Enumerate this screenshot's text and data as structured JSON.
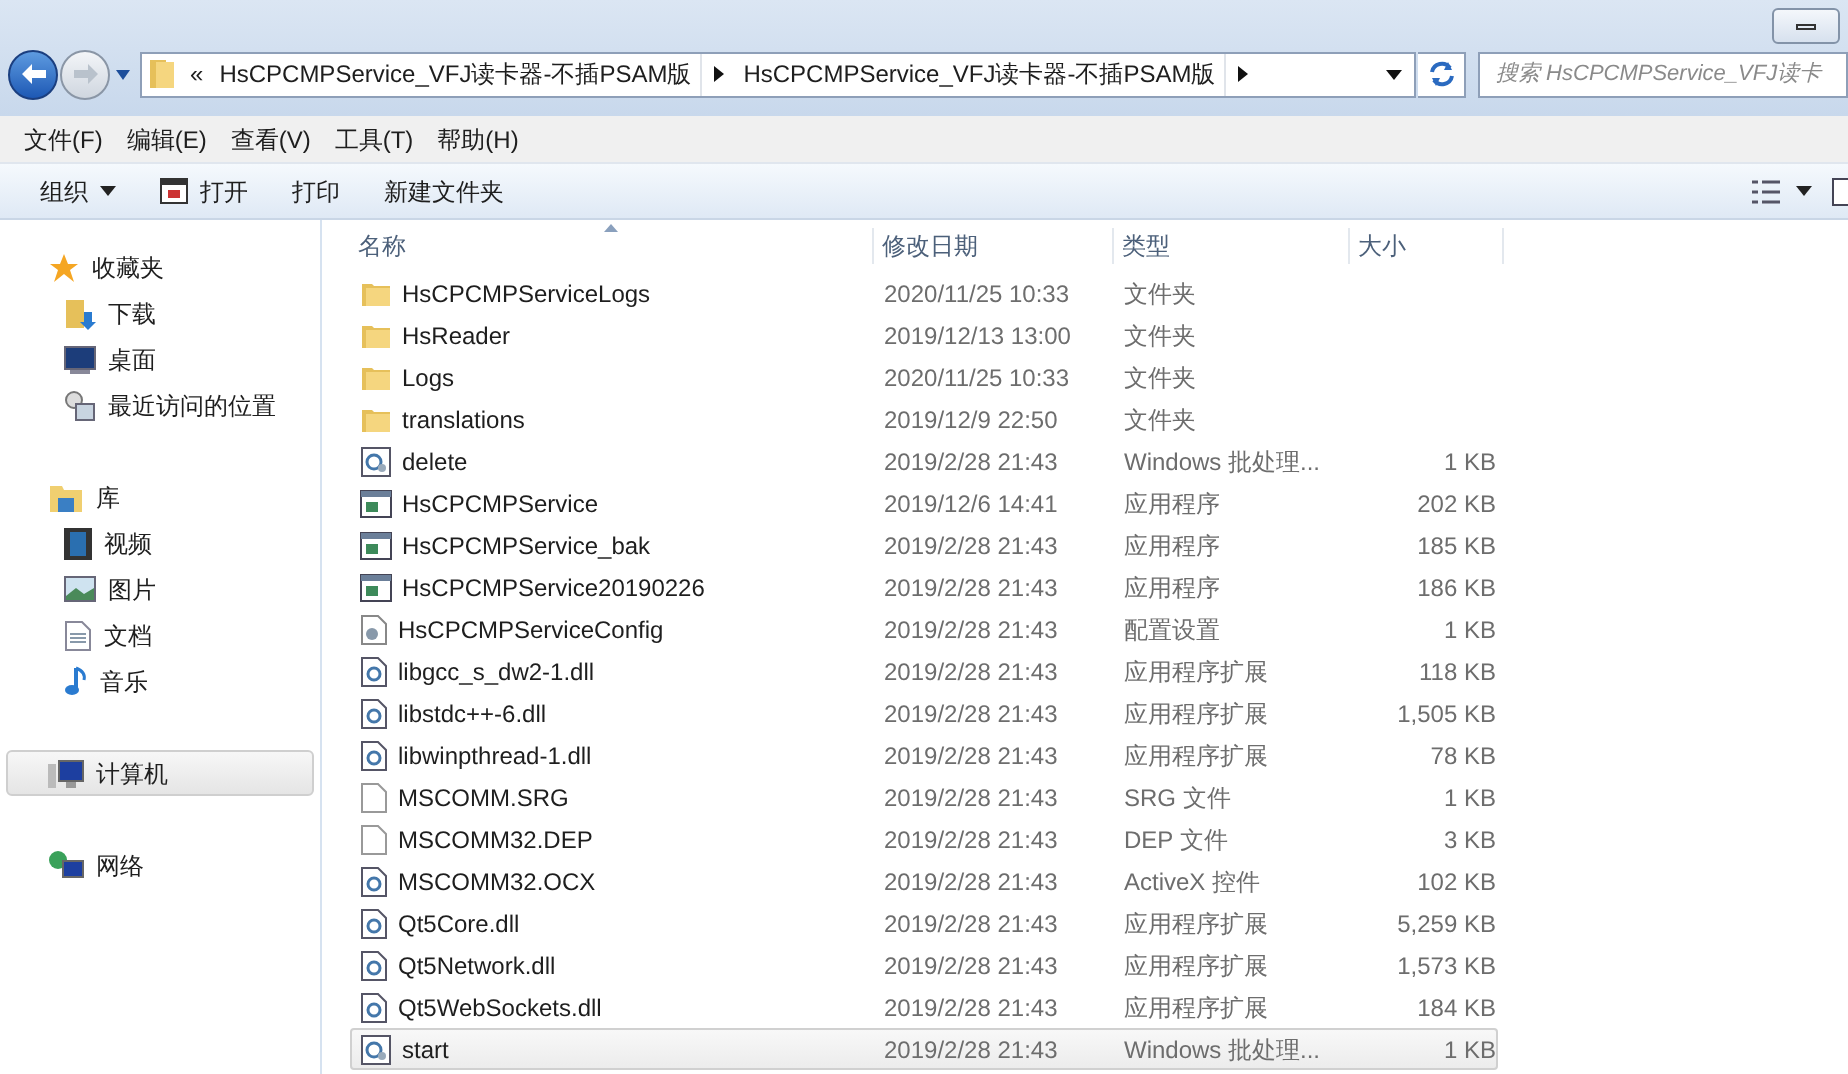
{
  "address_bar": {
    "overflow_marker": "«",
    "crumbs": [
      "HsCPCMPService_VFJ读卡器-不插PSAM版",
      "HsCPCMPService_VFJ读卡器-不插PSAM版"
    ]
  },
  "search": {
    "placeholder": "搜索 HsCPCMPService_VFJ读卡"
  },
  "menu": [
    "文件(F)",
    "编辑(E)",
    "查看(V)",
    "工具(T)",
    "帮助(H)"
  ],
  "toolbar": [
    {
      "label": "组织",
      "kind": "dropdown"
    },
    {
      "label": "打开",
      "kind": "icon"
    },
    {
      "label": "打印",
      "kind": "plain"
    },
    {
      "label": "新建文件夹",
      "kind": "plain"
    }
  ],
  "sidebar": {
    "groups": [
      {
        "label": "收藏夹",
        "kind": "favorites",
        "selected": false,
        "children": [
          {
            "label": "下载",
            "kind": "download"
          },
          {
            "label": "桌面",
            "kind": "desktop"
          },
          {
            "label": "最近访问的位置",
            "kind": "recent"
          }
        ]
      },
      {
        "label": "库",
        "kind": "library",
        "selected": false,
        "children": [
          {
            "label": "视频",
            "kind": "video"
          },
          {
            "label": "图片",
            "kind": "picture"
          },
          {
            "label": "文档",
            "kind": "document"
          },
          {
            "label": "音乐",
            "kind": "music"
          }
        ]
      },
      {
        "label": "计算机",
        "kind": "computer",
        "selected": true
      },
      {
        "label": "网络",
        "kind": "network",
        "selected": false
      }
    ]
  },
  "table": {
    "columns": [
      "名称",
      "修改日期",
      "类型",
      "大小"
    ],
    "rows": [
      {
        "name": "HsCPCMPServiceLogs",
        "date": "2020/11/25 10:33",
        "type": "文件夹",
        "kind": "folder",
        "selected": false
      },
      {
        "name": "HsReader",
        "date": "2019/12/13 13:00",
        "type": "文件夹",
        "kind": "folder",
        "selected": false
      },
      {
        "name": "Logs",
        "date": "2020/11/25 10:33",
        "type": "文件夹",
        "kind": "folder",
        "selected": false
      },
      {
        "name": "translations",
        "date": "2019/12/9 22:50",
        "type": "文件夹",
        "kind": "folder",
        "selected": false
      },
      {
        "name": "delete",
        "date": "2019/2/28 21:43",
        "type": "Windows 批处理...",
        "size": "1 KB",
        "kind": "batch",
        "selected": false
      },
      {
        "name": "HsCPCMPService",
        "date": "2019/12/6 14:41",
        "type": "应用程序",
        "size": "202 KB",
        "kind": "exe",
        "selected": false
      },
      {
        "name": "HsCPCMPService_bak",
        "date": "2019/2/28 21:43",
        "type": "应用程序",
        "size": "185 KB",
        "kind": "exe",
        "selected": false
      },
      {
        "name": "HsCPCMPService20190226",
        "date": "2019/2/28 21:43",
        "type": "应用程序",
        "size": "186 KB",
        "kind": "exe",
        "selected": false
      },
      {
        "name": "HsCPCMPServiceConfig",
        "date": "2019/2/28 21:43",
        "type": "配置设置",
        "size": "1 KB",
        "kind": "config",
        "selected": false
      },
      {
        "name": "libgcc_s_dw2-1.dll",
        "date": "2019/2/28 21:43",
        "type": "应用程序扩展",
        "size": "118 KB",
        "kind": "dll",
        "selected": false
      },
      {
        "name": "libstdc++-6.dll",
        "date": "2019/2/28 21:43",
        "type": "应用程序扩展",
        "size": "1,505 KB",
        "kind": "dll",
        "selected": false
      },
      {
        "name": "libwinpthread-1.dll",
        "date": "2019/2/28 21:43",
        "type": "应用程序扩展",
        "size": "78 KB",
        "kind": "dll",
        "selected": false
      },
      {
        "name": "MSCOMM.SRG",
        "date": "2019/2/28 21:43",
        "type": "SRG 文件",
        "size": "1 KB",
        "kind": "file",
        "selected": false
      },
      {
        "name": "MSCOMM32.DEP",
        "date": "2019/2/28 21:43",
        "type": "DEP 文件",
        "size": "3 KB",
        "kind": "file",
        "selected": false
      },
      {
        "name": "MSCOMM32.OCX",
        "date": "2019/2/28 21:43",
        "type": "ActiveX 控件",
        "size": "102 KB",
        "kind": "dll",
        "selected": false
      },
      {
        "name": "Qt5Core.dll",
        "date": "2019/2/28 21:43",
        "type": "应用程序扩展",
        "size": "5,259 KB",
        "kind": "dll",
        "selected": false
      },
      {
        "name": "Qt5Network.dll",
        "date": "2019/2/28 21:43",
        "type": "应用程序扩展",
        "size": "1,573 KB",
        "kind": "dll",
        "selected": false
      },
      {
        "name": "Qt5WebSockets.dll",
        "date": "2019/2/28 21:43",
        "type": "应用程序扩展",
        "size": "184 KB",
        "kind": "dll",
        "selected": false
      },
      {
        "name": "start",
        "date": "2019/2/28 21:43",
        "type": "Windows 批处理...",
        "size": "1 KB",
        "kind": "batch",
        "selected": true
      }
    ]
  }
}
